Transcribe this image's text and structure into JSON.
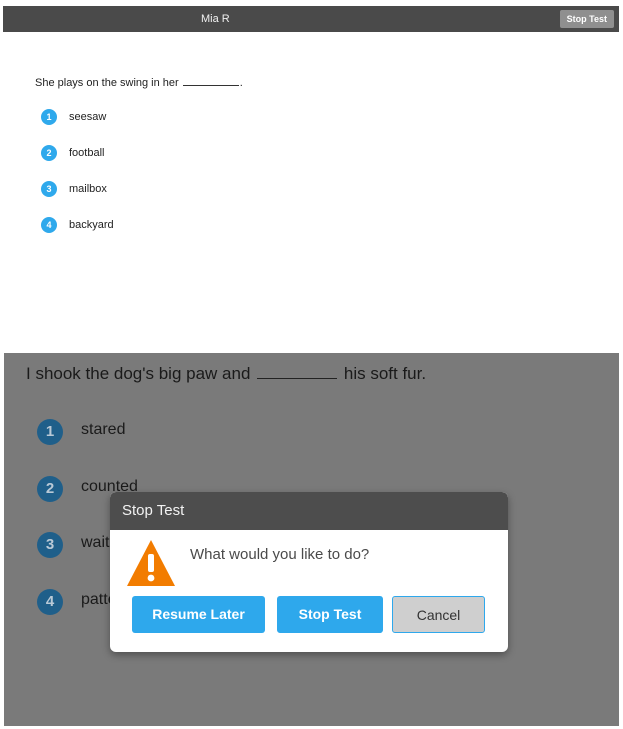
{
  "top": {
    "student_name": "Mia R",
    "stop_test_label": "Stop Test",
    "question_prefix": "She plays on the swing in her ",
    "question_suffix": ".",
    "options": [
      {
        "number": "1",
        "label": "seesaw"
      },
      {
        "number": "2",
        "label": "football"
      },
      {
        "number": "3",
        "label": "mailbox"
      },
      {
        "number": "4",
        "label": "backyard"
      }
    ]
  },
  "bottom": {
    "question_prefix": "I shook the dog's big paw and ",
    "question_suffix": " his soft fur.",
    "options": [
      {
        "number": "1",
        "label": "stared"
      },
      {
        "number": "2",
        "label": "counted"
      },
      {
        "number": "3",
        "label": "waited"
      },
      {
        "number": "4",
        "label": "patted"
      }
    ]
  },
  "modal": {
    "title": "Stop Test",
    "prompt": "What would you like to do?",
    "resume_label": "Resume Later",
    "stop_label": "Stop Test",
    "cancel_label": "Cancel",
    "icon": "warning-icon"
  },
  "colors": {
    "accent": "#2ea8ec",
    "topbar": "#4a4a4a",
    "overlay": "#7a7a7a",
    "warning": "#f27c00"
  }
}
